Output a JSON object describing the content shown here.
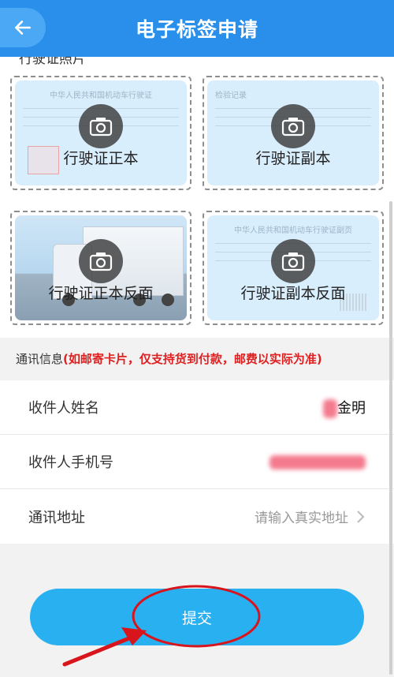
{
  "header": {
    "title": "电子标签申请",
    "back_icon": "arrow-left-icon"
  },
  "photos": {
    "section_label": "行驶证照片",
    "cards": [
      {
        "label": "行驶证正本",
        "doc_title": "中华人民共和国机动车行驶证"
      },
      {
        "label": "行驶证副本",
        "doc_title": "检验记录"
      },
      {
        "label": "行驶证正本反面",
        "doc_title": ""
      },
      {
        "label": "行驶证副本反面",
        "doc_title": "中华人民共和国机动车行驶证副页"
      }
    ]
  },
  "contact": {
    "label": "通讯信息",
    "note": "(如邮寄卡片，仅支持货到付款，邮费以实际为准)"
  },
  "form": {
    "name_label": "收件人姓名",
    "name_value": "金明",
    "phone_label": "收件人手机号",
    "address_label": "通讯地址",
    "address_placeholder": "请输入真实地址"
  },
  "submit": {
    "label": "提交"
  },
  "colors": {
    "header": "#2a8fea",
    "submit": "#29b0f0",
    "note": "#e02020",
    "annotation": "#d8141c"
  }
}
